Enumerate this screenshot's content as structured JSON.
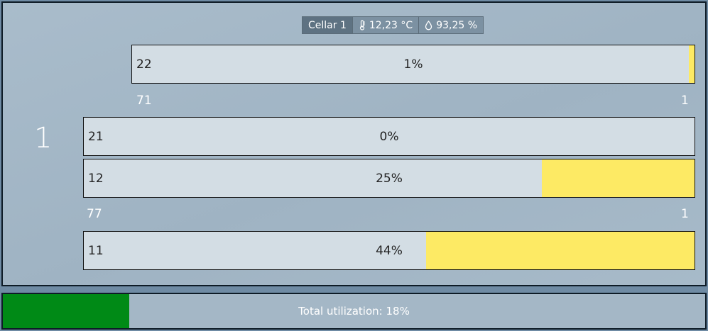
{
  "header": {
    "cellar": "Cellar 1",
    "temperature": "12,23 °C",
    "humidity": "93,25 %",
    "temperature_icon": "thermometer-icon",
    "humidity_icon": "droplet-icon"
  },
  "row_number": "1",
  "slots": [
    {
      "number": "22",
      "percent_label": "1%",
      "fill_fraction": 0.01
    },
    {
      "number": "21",
      "percent_label": "0%",
      "fill_fraction": 0.0
    },
    {
      "number": "12",
      "percent_label": "25%",
      "fill_fraction": 0.25
    },
    {
      "number": "11",
      "percent_label": "44%",
      "fill_fraction": 0.44
    }
  ],
  "group_labels": [
    {
      "left": "71",
      "right": "1"
    },
    {
      "left": "77",
      "right": "1"
    }
  ],
  "footer": {
    "label": "Total utilization: 18%",
    "fill_fraction": 0.18
  },
  "colors": {
    "fill_yellow": "#fdea64",
    "fill_green": "#008a16",
    "slot_bg": "#d3dde4"
  }
}
